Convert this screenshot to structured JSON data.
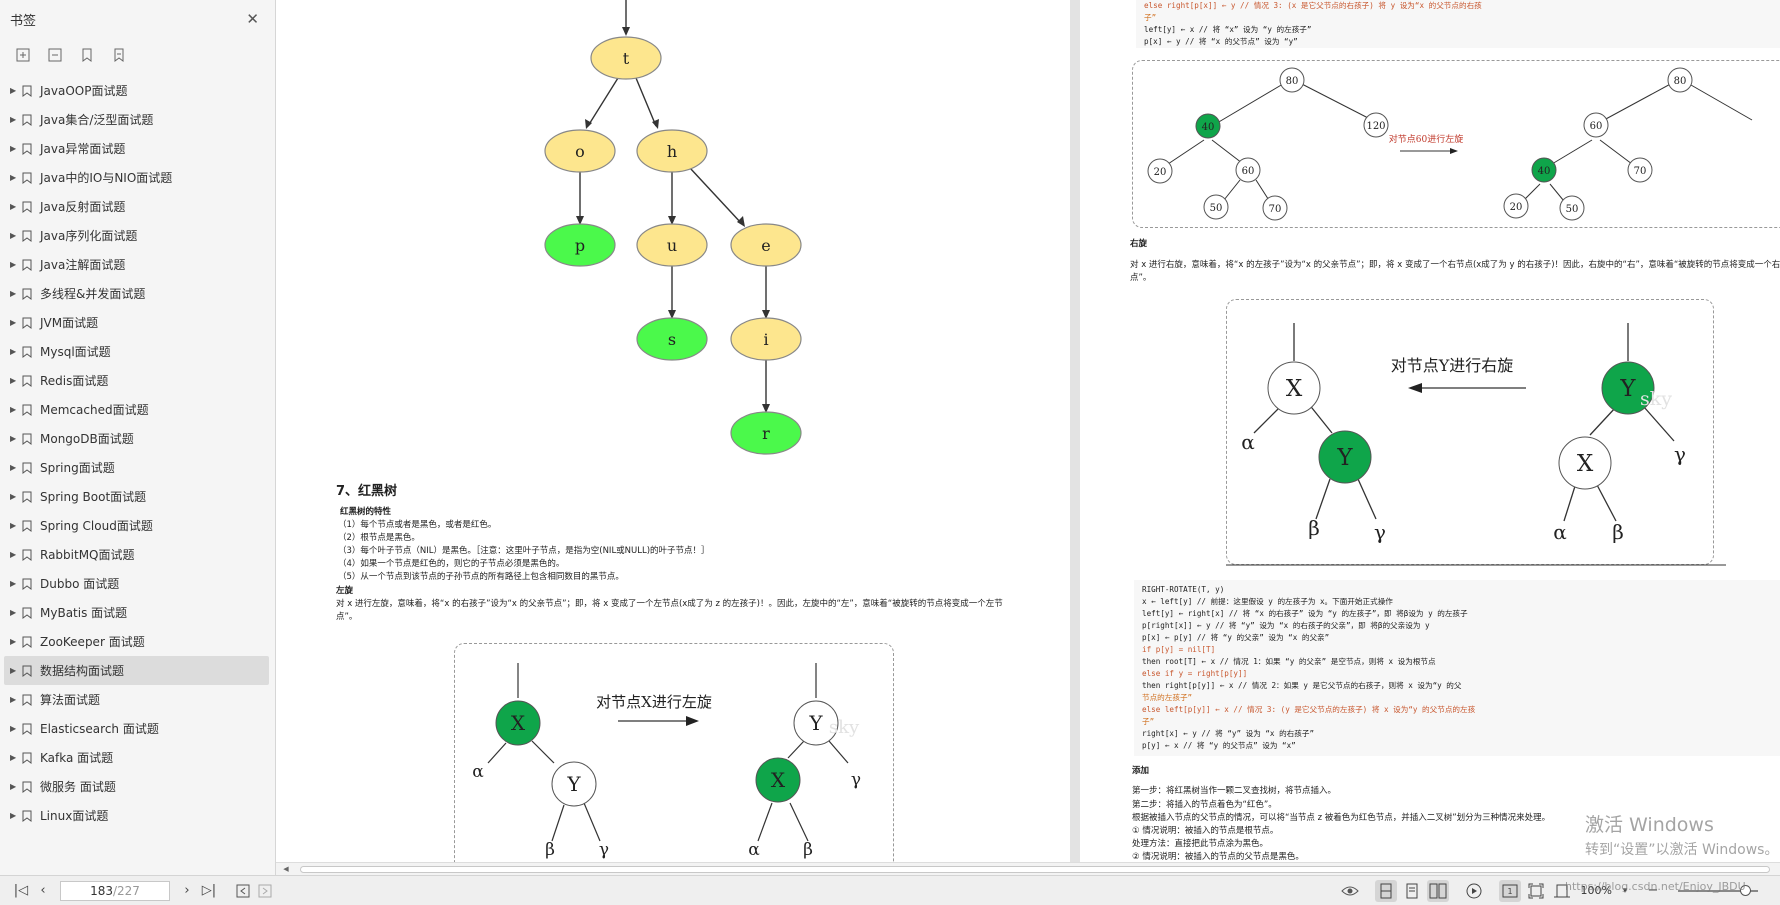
{
  "sidebar": {
    "title": "书签",
    "items": [
      {
        "label": "JavaOOP面试题"
      },
      {
        "label": "Java集合/泛型面试题"
      },
      {
        "label": "Java异常面试题"
      },
      {
        "label": "Java中的IO与NIO面试题"
      },
      {
        "label": "Java反射面试题"
      },
      {
        "label": "Java序列化面试题"
      },
      {
        "label": "Java注解面试题"
      },
      {
        "label": "多线程&并发面试题"
      },
      {
        "label": "JVM面试题"
      },
      {
        "label": "Mysql面试题"
      },
      {
        "label": "Redis面试题"
      },
      {
        "label": "Memcached面试题"
      },
      {
        "label": "MongoDB面试题"
      },
      {
        "label": "Spring面试题"
      },
      {
        "label": "Spring Boot面试题"
      },
      {
        "label": "Spring Cloud面试题"
      },
      {
        "label": "RabbitMQ面试题"
      },
      {
        "label": "Dubbo 面试题"
      },
      {
        "label": "MyBatis 面试题"
      },
      {
        "label": "ZooKeeper 面试题"
      },
      {
        "label": "数据结构面试题",
        "active": true
      },
      {
        "label": "算法面试题"
      },
      {
        "label": "Elasticsearch 面试题"
      },
      {
        "label": "Kafka 面试题"
      },
      {
        "label": "微服务 面试题"
      },
      {
        "label": "Linux面试题"
      }
    ]
  },
  "tree": {
    "nodes": [
      "t",
      "o",
      "h",
      "p",
      "u",
      "e",
      "s",
      "i",
      "r"
    ],
    "colors": {
      "yellow": "#fde68e",
      "green": "#4bf94b",
      "stroke": "#888888"
    }
  },
  "page_left": {
    "heading": "7、红黑树",
    "rb_title": "红黑树的特性",
    "rules": [
      "（1）每个节点或者是黑色，或者是红色。",
      "（2）根节点是黑色。",
      "（3）每个叶子节点（NIL）是黑色。［注意：这里叶子节点，是指为空(NIL或NULL)的叶子节点！］",
      "（4）如果一个节点是红色的，则它的子节点必须是黑色的。",
      "（5）从一个节点到该节点的子孙节点的所有路径上包含相同数目的黑节点。"
    ],
    "left_title": "左旋",
    "left_desc1": "对 x 进行左旋，意味着，将“x 的右孩子”设为“x 的父亲节点”；即，将 x 变成了一个左节点(x成了为 z 的左孩子)！。因此，左旋中的“左”，意味着“被旋转的节点将变成一个左节",
    "left_desc2": "点”。",
    "left_diagram": {
      "caption": "对节点X进行左旋",
      "x": "X",
      "y": "Y",
      "alpha": "α",
      "beta": "β",
      "gamma": "γ",
      "sky": "sky"
    }
  },
  "page_right": {
    "code_top": {
      "l1": "else right[p[x]] ← y // 情况 3: (x 是它父节点的右孩子) 将 y 设为“x 的父节点的右孩",
      "l2": "子”",
      "l3": "left[y] ← x // 将 “x” 设为 “y 的左孩子”",
      "l4": "p[x] ← y // 将 “x 的父节点” 设为 “y”"
    },
    "small_tree": {
      "caption": "对节点60进行左旋",
      "left_nodes": [
        "80",
        "40",
        "120",
        "20",
        "60",
        "50",
        "70"
      ],
      "right_nodes": [
        "80",
        "60",
        "40",
        "70",
        "20",
        "50"
      ]
    },
    "right_title": "右旋",
    "right_desc1": "对 x 进行右旋，意味着，将“x 的左孩子”设为“x 的父亲节点”；即，将 x 变成了一个右节点(x成了为 y 的右孩子)！因此，右旋中的“右”，意味着“被旋转的节点将变成一个右节",
    "right_desc2": "点”。",
    "right_diagram": {
      "caption": "对节点Y进行右旋",
      "x": "X",
      "y": "Y",
      "alpha": "α",
      "beta": "β",
      "gamma": "γ",
      "sky": "sky"
    },
    "code_bottom": [
      "RIGHT-ROTATE(T, y)",
      "x ← left[y] // 前提：这里假设 y 的左孩子为 x。下面开始正式操作",
      "left[y] ← right[x] // 将 “x 的右孩子” 设为 “y 的左孩子”，即 将β设为 y 的左孩子",
      "p[right[x]] ← y // 将 “y” 设为 “x 的右孩子的父亲”，即 将β的父亲设为 y",
      "p[x] ← p[y] // 将 “y 的父亲” 设为 “x 的父亲”",
      "if p[y] = nil[T]",
      "then root[T] ← x // 情况 1：如果 “y 的父亲” 是空节点，则将 x 设为根节点",
      "else if y = right[p[y]]",
      "then right[p[y]] ← x // 情况 2：如果 y 是它父节点的右孩子，则将 x 设为“y 的父",
      "节点的左孩子”",
      "else left[p[y]] ← x // 情况 3: (y 是它父节点的左孩子) 将 x 设为“y 的父节点的左孩",
      "子”",
      "right[x] ← y // 将 “y” 设为 “x 的右孩子”",
      "p[y] ← x // 将 “y 的父节点” 设为 “x”"
    ],
    "add_title": "添加",
    "add_lines": [
      "第一步：将红黑树当作一颗二叉查找树，将节点插入。",
      "第二步：将插入的节点着色为“红色”。",
      "根据被插入节点的父节点的情况，可以将“当节点 z 被着色为红色节点，并插入二叉树”划分为三种情况来处理。",
      "① 情况说明：被插入的节点是根节点。",
      "处理方法：直接把此节点涂为黑色。",
      "② 情况说明：被插入的节点的父节点是黑色。"
    ]
  },
  "toolbar": {
    "page_current": "183",
    "page_total": "/227",
    "zoom": "100%"
  },
  "watermark": {
    "line1": "激活 Windows",
    "line2": "转到“设置”以激活 Windows。",
    "csdn": "https://blog.csdn.net/Enjoy_JBDU"
  }
}
